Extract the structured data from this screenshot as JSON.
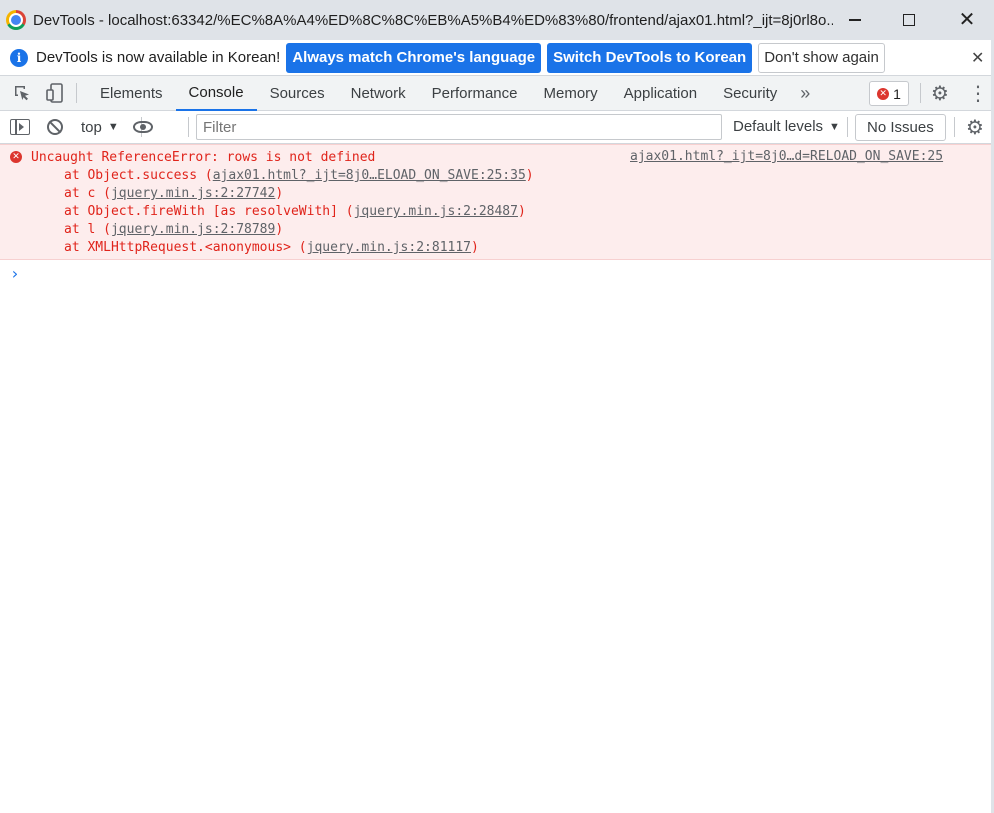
{
  "window": {
    "title": "DevTools - localhost:63342/%EC%8A%A4%ED%8C%8C%EB%A5%B4%ED%83%80/frontend/ajax01.html?_ijt=8j0rl8o...",
    "close_glyph": "✕"
  },
  "infobar": {
    "message": "DevTools is now available in Korean!",
    "btn_match": "Always match Chrome's language",
    "btn_switch": "Switch DevTools to Korean",
    "btn_dismiss": "Don't show again",
    "close_glyph": "✕"
  },
  "tabs": [
    {
      "label": "Elements"
    },
    {
      "label": "Console"
    },
    {
      "label": "Sources"
    },
    {
      "label": "Network"
    },
    {
      "label": "Performance"
    },
    {
      "label": "Memory"
    },
    {
      "label": "Application"
    },
    {
      "label": "Security"
    }
  ],
  "tabbar": {
    "more_glyph": "»",
    "error_count": "1",
    "error_glyph": "✕",
    "gear_glyph": "⚙",
    "kebab_glyph": "⋮"
  },
  "console_toolbar": {
    "context": "top",
    "dropdown_glyph": "▼",
    "filter_placeholder": "Filter",
    "levels": "Default levels",
    "issues": "No Issues",
    "gear_glyph": "⚙"
  },
  "error": {
    "message": "Uncaught ReferenceError: rows is not defined",
    "source": "ajax01.html?_ijt=8j0…d=RELOAD_ON_SAVE:25",
    "error_glyph": "✕",
    "stack": [
      {
        "prefix": "at Object.success (",
        "link": "ajax01.html?_ijt=8j0…ELOAD_ON_SAVE:25:35",
        "suffix": ")"
      },
      {
        "prefix": "at c (",
        "link": "jquery.min.js:2:27742",
        "suffix": ")"
      },
      {
        "prefix": "at Object.fireWith [as resolveWith] (",
        "link": "jquery.min.js:2:28487",
        "suffix": ")"
      },
      {
        "prefix": "at l (",
        "link": "jquery.min.js:2:78789",
        "suffix": ")"
      },
      {
        "prefix": "at XMLHttpRequest.<anonymous> (",
        "link": "jquery.min.js:2:81117",
        "suffix": ")"
      }
    ]
  },
  "prompt": "›",
  "colors": {
    "accent": "#1a73e8",
    "error": "#e0241b",
    "error_bg": "#fdeded"
  }
}
